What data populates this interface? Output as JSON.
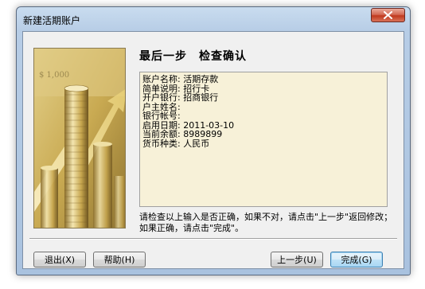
{
  "window": {
    "title": "新建活期账户"
  },
  "heading": "最后一步　检查确认",
  "summary": {
    "lines": [
      "账户名称: 活期存款",
      "简单说明: 招行卡",
      "开户银行: 招商银行",
      "户主姓名:",
      "银行帐号:",
      "启用日期: 2011-03-10",
      "当前余额: 8989899",
      "货币种类: 人民币"
    ]
  },
  "instruction": "请检查以上输入是否正确，如果不对，请点击\"上一步\"返回修改；如果正确，请点击\"完成\"。",
  "image": {
    "price_tag": "$ 1,000"
  },
  "buttons": {
    "exit": "退出(X)",
    "help": "帮助(H)",
    "back": "上一步(U)",
    "finish": "完成(G)"
  },
  "colors": {
    "summary_bg": "#f7f1d8",
    "image_gold": "#c9a94a",
    "close_red": "#c0391e"
  },
  "icons": {
    "close": "close-icon"
  }
}
